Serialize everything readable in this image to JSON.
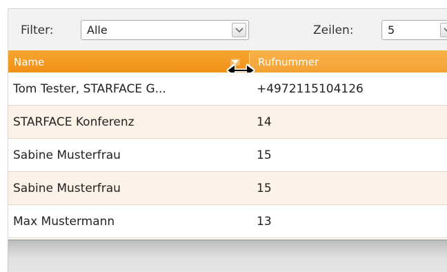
{
  "toolbar": {
    "filter_label": "Filter:",
    "filter_value": "Alle",
    "rows_label": "Zeilen:",
    "rows_value": "5"
  },
  "table": {
    "columns": [
      "Name",
      "Rufnummer"
    ],
    "rows": [
      {
        "name": "Tom Tester, STARFACE G...",
        "number": "+4972115104126"
      },
      {
        "name": "STARFACE Konferenz",
        "number": "14"
      },
      {
        "name": "Sabine Musterfrau",
        "number": "15"
      },
      {
        "name": "Sabine Musterfrau",
        "number": "15"
      },
      {
        "name": "Max Mustermann",
        "number": "13"
      }
    ]
  },
  "icons": {
    "filter_dropdown": "chevron-down-icon",
    "rows_dropdown": "chevron-down-icon",
    "sort": "sort-descending-icon",
    "cursor": "column-resize-cursor-icon"
  },
  "colors": {
    "header_accent": "#f39c1f",
    "header_secondary": "#f9b24a",
    "row_alt": "#fdf2e7"
  }
}
